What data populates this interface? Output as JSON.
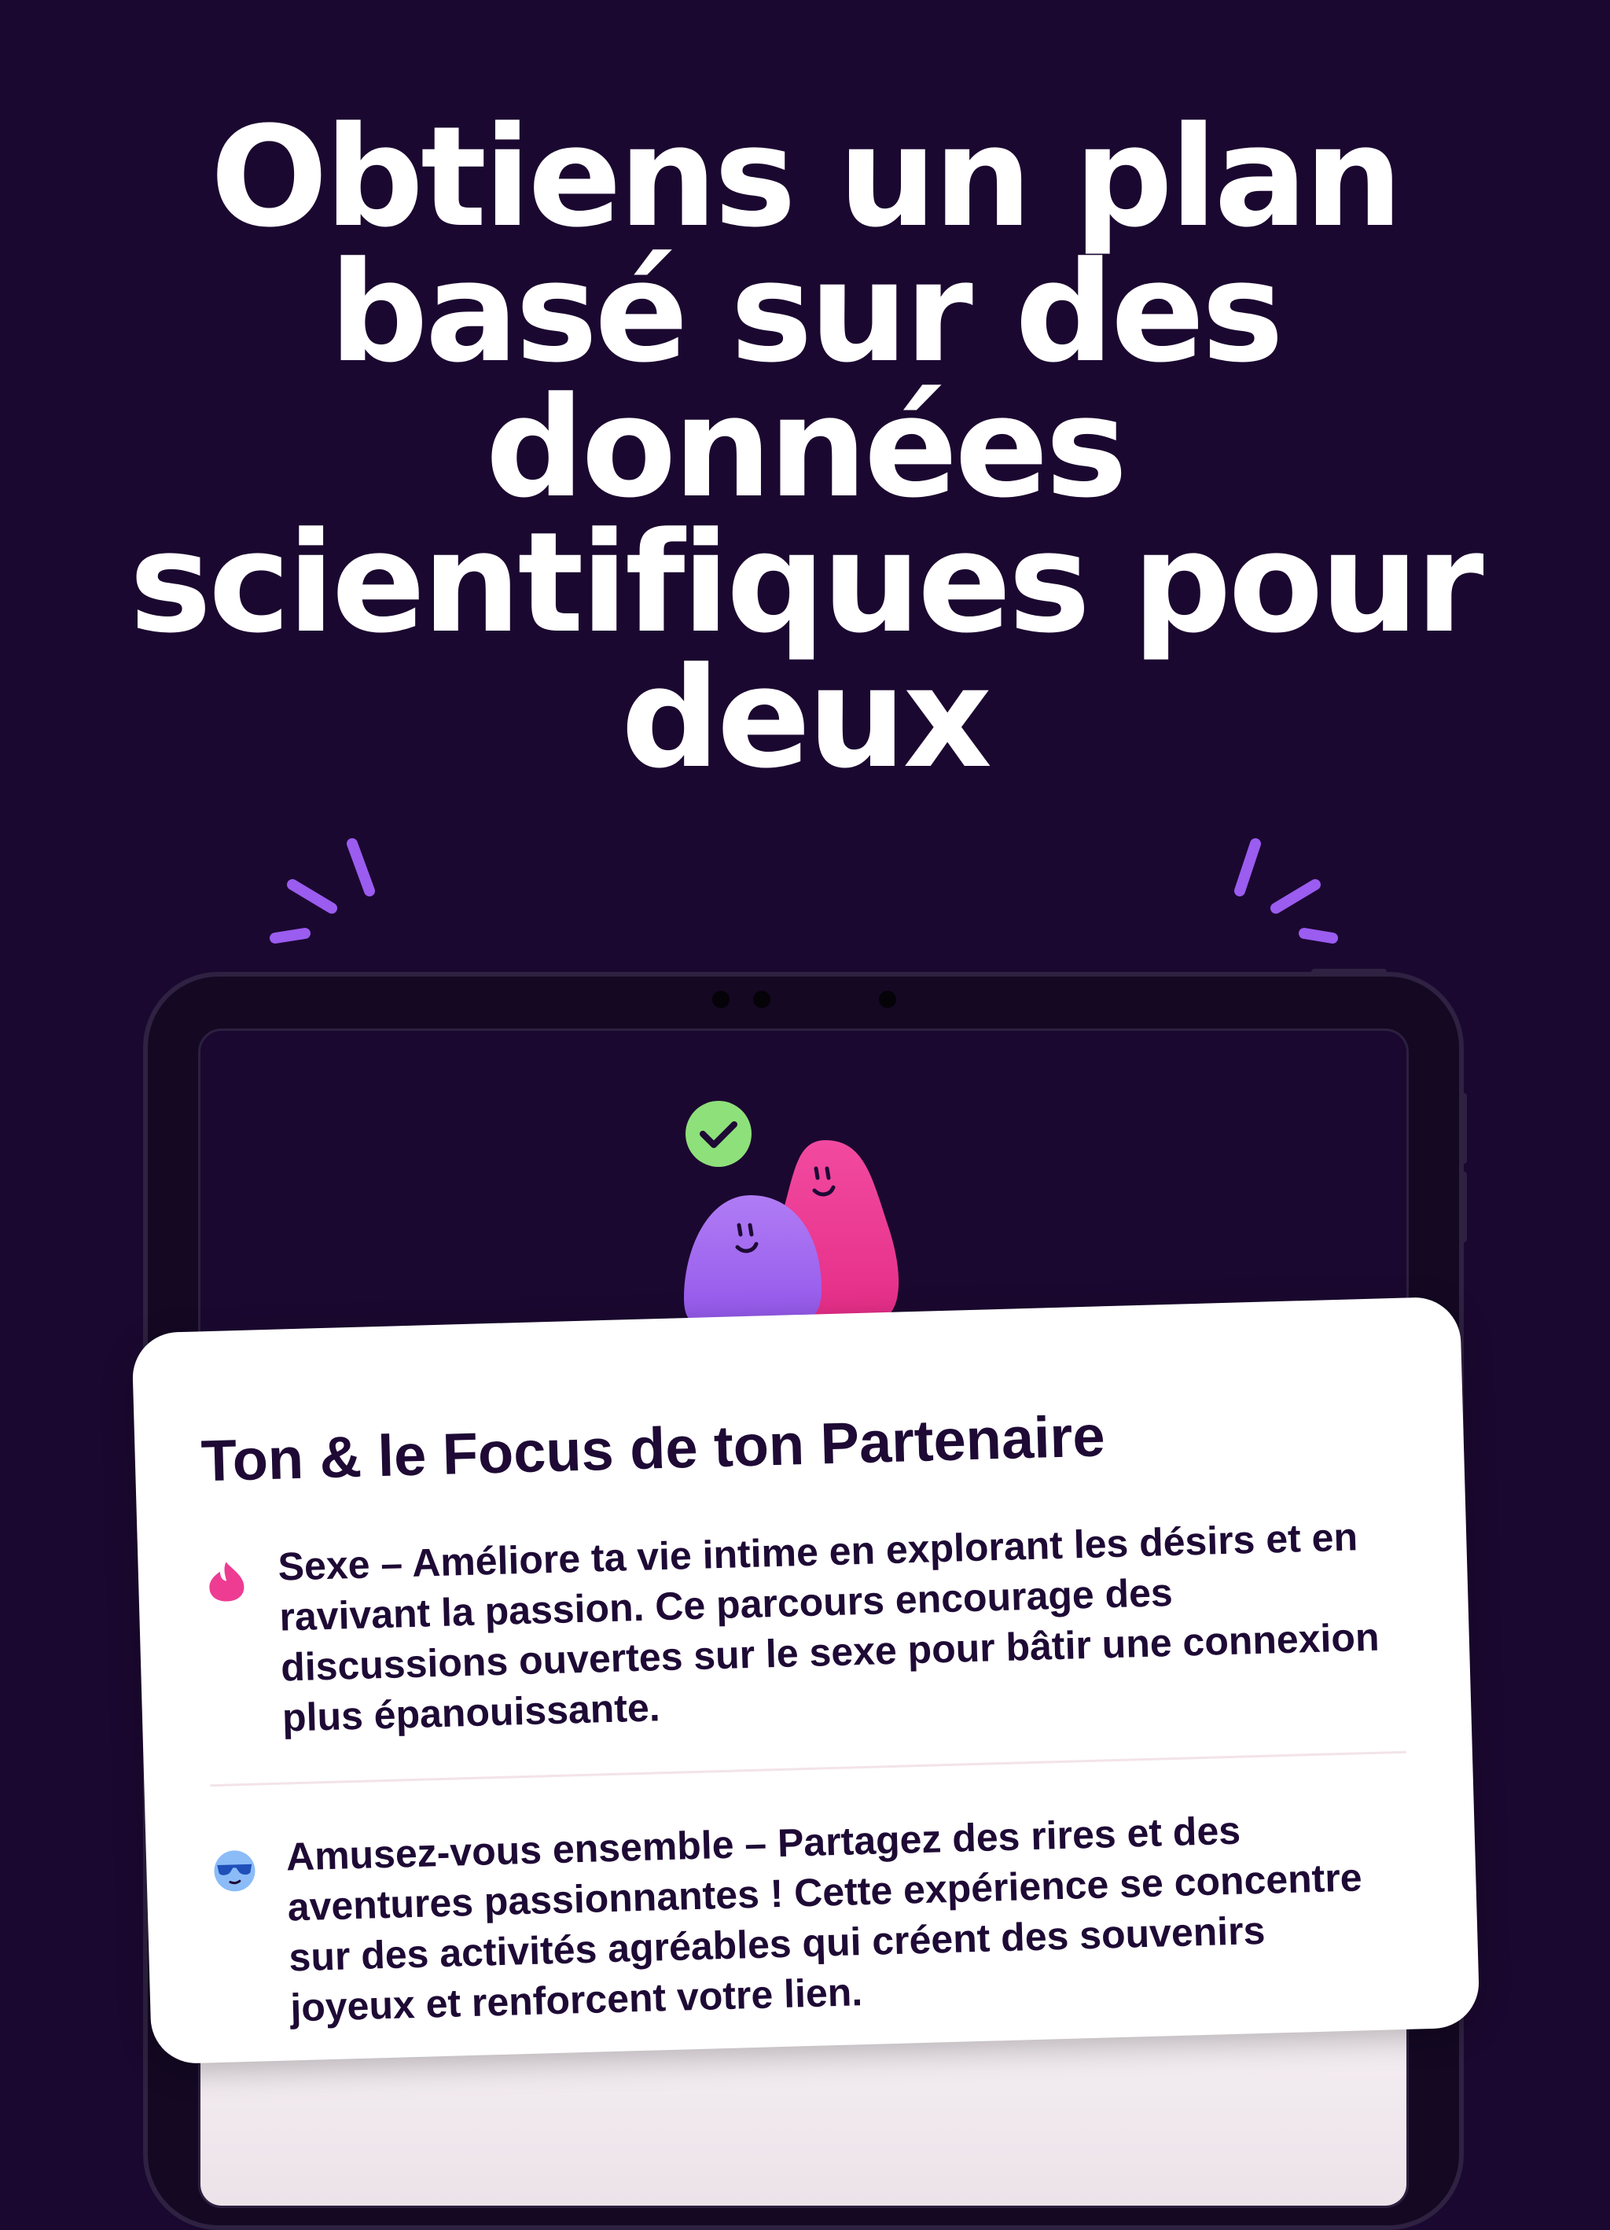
{
  "headline": {
    "lines": [
      "Obtiens un plan",
      "basé sur des",
      "données",
      "scientifiques pour",
      "deux"
    ]
  },
  "card": {
    "title": "Ton & le Focus de ton Partenaire",
    "items": [
      {
        "icon": "flame-icon",
        "icon_color": "#ee3c93",
        "text": "Sexe – Améliore ta vie intime en explorant les désirs et en ravivant la passion. Ce parcours encourage des discussions ouvertes sur le sexe pour bâtir une connexion plus épanouissante."
      },
      {
        "icon": "sunglasses-face-icon",
        "icon_color": "#5b9bf0",
        "text": "Amusez-vous ensemble – Partagez des rires et des aventures passionnantes ! Cette expérience se concentre sur des activités agréables qui créent des souvenirs joyeux et renforcent votre lien."
      }
    ]
  },
  "colors": {
    "background": "#1b0830",
    "accent_purple": "#9b5cf0",
    "accent_pink": "#ee3c93",
    "check_green": "#8ee07a"
  }
}
